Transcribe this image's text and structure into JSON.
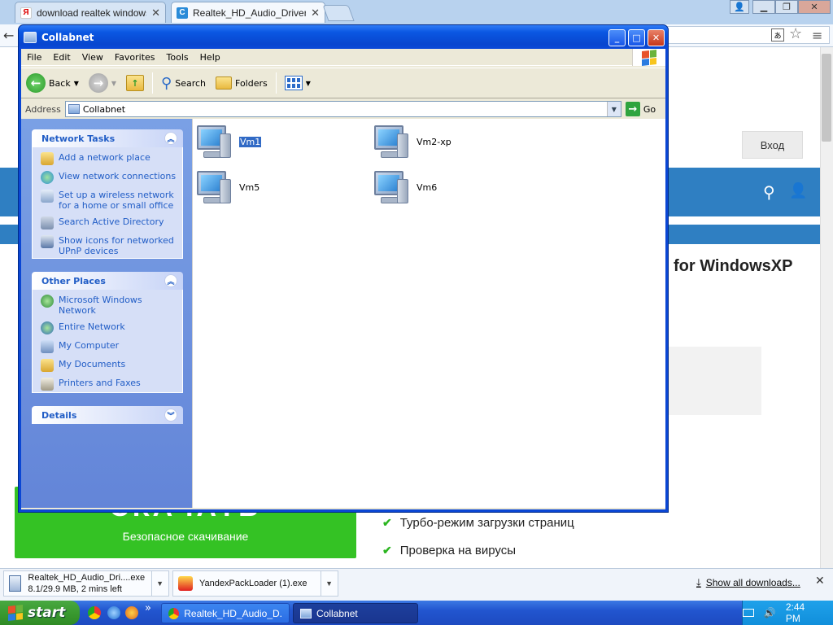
{
  "browser": {
    "tabs": [
      {
        "title": "download realtek windows xp",
        "favicon": "Я"
      },
      {
        "title": "Realtek_HD_Audio_Drivers_",
        "favicon": "C"
      }
    ],
    "window_buttons": [
      "user-icon",
      "minimize-icon",
      "restore-icon",
      "close-icon"
    ]
  },
  "webpage": {
    "login_button": "Вход",
    "heading": "for WindowsXP",
    "download_button_title": "СКАЧАТЬ",
    "download_button_subtitle": "Безопасное скачивание",
    "features": [
      "Турбо-режим загрузки страниц",
      "Проверка на вирусы"
    ]
  },
  "explorer": {
    "title": "Collabnet",
    "menu": [
      "File",
      "Edit",
      "View",
      "Favorites",
      "Tools",
      "Help"
    ],
    "toolbar": {
      "back": "Back",
      "search": "Search",
      "folders": "Folders"
    },
    "address_label": "Address",
    "address_value": "Collabnet",
    "go_label": "Go",
    "network_tasks": {
      "title": "Network Tasks",
      "items": [
        {
          "label": "Add a network place",
          "icon": "add-network-place-icon"
        },
        {
          "label": "View network connections",
          "icon": "network-connections-icon"
        },
        {
          "label": "Set up a wireless network for a home or small office",
          "icon": "wireless-network-icon"
        },
        {
          "label": "Search Active Directory",
          "icon": "search-directory-icon"
        },
        {
          "label": "Show icons for networked UPnP devices",
          "icon": "upnp-devices-icon"
        }
      ]
    },
    "other_places": {
      "title": "Other Places",
      "items": [
        {
          "label": "Microsoft Windows Network",
          "icon": "windows-network-icon"
        },
        {
          "label": "Entire Network",
          "icon": "entire-network-icon"
        },
        {
          "label": "My Computer",
          "icon": "my-computer-icon"
        },
        {
          "label": "My Documents",
          "icon": "my-documents-icon"
        },
        {
          "label": "Printers and Faxes",
          "icon": "printers-faxes-icon"
        }
      ]
    },
    "details": {
      "title": "Details"
    },
    "computers": [
      {
        "name": "Vm1",
        "selected": true
      },
      {
        "name": "Vm2-xp",
        "selected": false
      },
      {
        "name": "Vm5",
        "selected": false
      },
      {
        "name": "Vm6",
        "selected": false
      }
    ]
  },
  "downloads": {
    "items": [
      {
        "name": "Realtek_HD_Audio_Dri....exe",
        "status": "8.1/29.9 MB, 2 mins left"
      },
      {
        "name": "YandexPackLoader (1).exe",
        "status": ""
      }
    ],
    "show_all": "Show all downloads..."
  },
  "taskbar": {
    "start": "start",
    "tasks": [
      "Realtek_HD_Audio_D...",
      "Collabnet"
    ],
    "clock": "2:44 PM",
    "quick_launch_more": "»"
  },
  "colors": {
    "xp_blue": "#0a46d4",
    "xp_taskpane": "#6385d8",
    "web_blue": "#2f7fc2",
    "download_green": "#34c224",
    "start_green": "#3a9a30"
  }
}
